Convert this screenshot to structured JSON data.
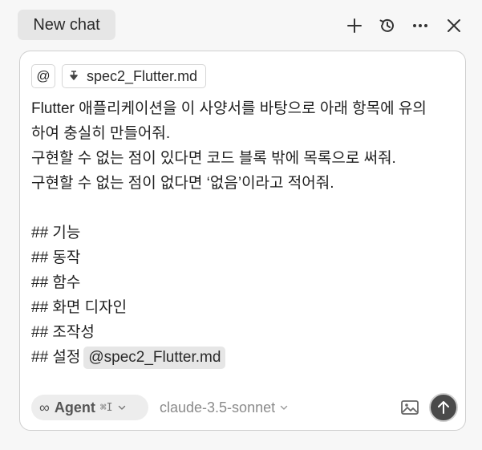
{
  "header": {
    "tab_label": "New chat"
  },
  "composer": {
    "at_symbol": "@",
    "attached_file": "spec2_Flutter.md",
    "lines": [
      "Flutter 애플리케이션을 이 사양서를 바탕으로 아래 항목에 유의",
      "하여 충실히 만들어줘.",
      "구현할 수 없는 점이 있다면 코드 블록 밖에 목록으로 써줘.",
      "구현할 수 없는 점이 없다면 ‘없음’이라고 적어줘.",
      "",
      "## 기능",
      "## 동작",
      "## 함수",
      "## 화면 디자인",
      "## 조작성"
    ],
    "last_line_prefix": "## 설정",
    "last_line_mention": "@spec2_Flutter.md"
  },
  "toolbar": {
    "mode_symbol": "∞",
    "mode_label": "Agent",
    "mode_shortcut": "⌘I",
    "model_label": "claude-3.5-sonnet"
  },
  "icons": {
    "new": "plus-icon",
    "history": "history-icon",
    "more": "more-icon",
    "close": "close-icon",
    "file": "file-icon",
    "image": "image-icon",
    "send": "arrow-up-icon"
  },
  "colors": {
    "send_button": "#4a4a4a",
    "tab_bg": "#e6e6e6"
  }
}
